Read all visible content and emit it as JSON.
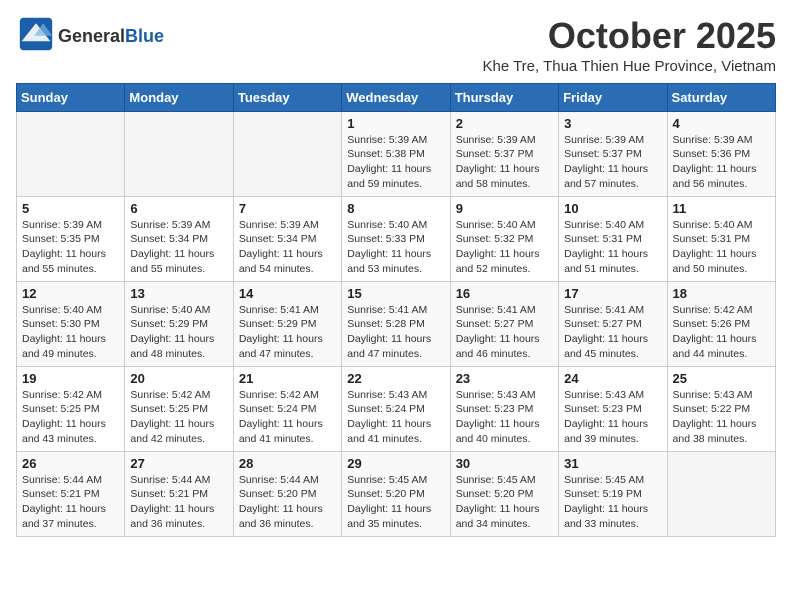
{
  "header": {
    "logo": {
      "line1": "General",
      "line2": "Blue"
    },
    "title": "October 2025",
    "subtitle": "Khe Tre, Thua Thien Hue Province, Vietnam"
  },
  "weekdays": [
    "Sunday",
    "Monday",
    "Tuesday",
    "Wednesday",
    "Thursday",
    "Friday",
    "Saturday"
  ],
  "weeks": [
    [
      {
        "day": "",
        "info": ""
      },
      {
        "day": "",
        "info": ""
      },
      {
        "day": "",
        "info": ""
      },
      {
        "day": "1",
        "info": "Sunrise: 5:39 AM\nSunset: 5:38 PM\nDaylight: 11 hours\nand 59 minutes."
      },
      {
        "day": "2",
        "info": "Sunrise: 5:39 AM\nSunset: 5:37 PM\nDaylight: 11 hours\nand 58 minutes."
      },
      {
        "day": "3",
        "info": "Sunrise: 5:39 AM\nSunset: 5:37 PM\nDaylight: 11 hours\nand 57 minutes."
      },
      {
        "day": "4",
        "info": "Sunrise: 5:39 AM\nSunset: 5:36 PM\nDaylight: 11 hours\nand 56 minutes."
      }
    ],
    [
      {
        "day": "5",
        "info": "Sunrise: 5:39 AM\nSunset: 5:35 PM\nDaylight: 11 hours\nand 55 minutes."
      },
      {
        "day": "6",
        "info": "Sunrise: 5:39 AM\nSunset: 5:34 PM\nDaylight: 11 hours\nand 55 minutes."
      },
      {
        "day": "7",
        "info": "Sunrise: 5:39 AM\nSunset: 5:34 PM\nDaylight: 11 hours\nand 54 minutes."
      },
      {
        "day": "8",
        "info": "Sunrise: 5:40 AM\nSunset: 5:33 PM\nDaylight: 11 hours\nand 53 minutes."
      },
      {
        "day": "9",
        "info": "Sunrise: 5:40 AM\nSunset: 5:32 PM\nDaylight: 11 hours\nand 52 minutes."
      },
      {
        "day": "10",
        "info": "Sunrise: 5:40 AM\nSunset: 5:31 PM\nDaylight: 11 hours\nand 51 minutes."
      },
      {
        "day": "11",
        "info": "Sunrise: 5:40 AM\nSunset: 5:31 PM\nDaylight: 11 hours\nand 50 minutes."
      }
    ],
    [
      {
        "day": "12",
        "info": "Sunrise: 5:40 AM\nSunset: 5:30 PM\nDaylight: 11 hours\nand 49 minutes."
      },
      {
        "day": "13",
        "info": "Sunrise: 5:40 AM\nSunset: 5:29 PM\nDaylight: 11 hours\nand 48 minutes."
      },
      {
        "day": "14",
        "info": "Sunrise: 5:41 AM\nSunset: 5:29 PM\nDaylight: 11 hours\nand 47 minutes."
      },
      {
        "day": "15",
        "info": "Sunrise: 5:41 AM\nSunset: 5:28 PM\nDaylight: 11 hours\nand 47 minutes."
      },
      {
        "day": "16",
        "info": "Sunrise: 5:41 AM\nSunset: 5:27 PM\nDaylight: 11 hours\nand 46 minutes."
      },
      {
        "day": "17",
        "info": "Sunrise: 5:41 AM\nSunset: 5:27 PM\nDaylight: 11 hours\nand 45 minutes."
      },
      {
        "day": "18",
        "info": "Sunrise: 5:42 AM\nSunset: 5:26 PM\nDaylight: 11 hours\nand 44 minutes."
      }
    ],
    [
      {
        "day": "19",
        "info": "Sunrise: 5:42 AM\nSunset: 5:25 PM\nDaylight: 11 hours\nand 43 minutes."
      },
      {
        "day": "20",
        "info": "Sunrise: 5:42 AM\nSunset: 5:25 PM\nDaylight: 11 hours\nand 42 minutes."
      },
      {
        "day": "21",
        "info": "Sunrise: 5:42 AM\nSunset: 5:24 PM\nDaylight: 11 hours\nand 41 minutes."
      },
      {
        "day": "22",
        "info": "Sunrise: 5:43 AM\nSunset: 5:24 PM\nDaylight: 11 hours\nand 41 minutes."
      },
      {
        "day": "23",
        "info": "Sunrise: 5:43 AM\nSunset: 5:23 PM\nDaylight: 11 hours\nand 40 minutes."
      },
      {
        "day": "24",
        "info": "Sunrise: 5:43 AM\nSunset: 5:23 PM\nDaylight: 11 hours\nand 39 minutes."
      },
      {
        "day": "25",
        "info": "Sunrise: 5:43 AM\nSunset: 5:22 PM\nDaylight: 11 hours\nand 38 minutes."
      }
    ],
    [
      {
        "day": "26",
        "info": "Sunrise: 5:44 AM\nSunset: 5:21 PM\nDaylight: 11 hours\nand 37 minutes."
      },
      {
        "day": "27",
        "info": "Sunrise: 5:44 AM\nSunset: 5:21 PM\nDaylight: 11 hours\nand 36 minutes."
      },
      {
        "day": "28",
        "info": "Sunrise: 5:44 AM\nSunset: 5:20 PM\nDaylight: 11 hours\nand 36 minutes."
      },
      {
        "day": "29",
        "info": "Sunrise: 5:45 AM\nSunset: 5:20 PM\nDaylight: 11 hours\nand 35 minutes."
      },
      {
        "day": "30",
        "info": "Sunrise: 5:45 AM\nSunset: 5:20 PM\nDaylight: 11 hours\nand 34 minutes."
      },
      {
        "day": "31",
        "info": "Sunrise: 5:45 AM\nSunset: 5:19 PM\nDaylight: 11 hours\nand 33 minutes."
      },
      {
        "day": "",
        "info": ""
      }
    ]
  ]
}
